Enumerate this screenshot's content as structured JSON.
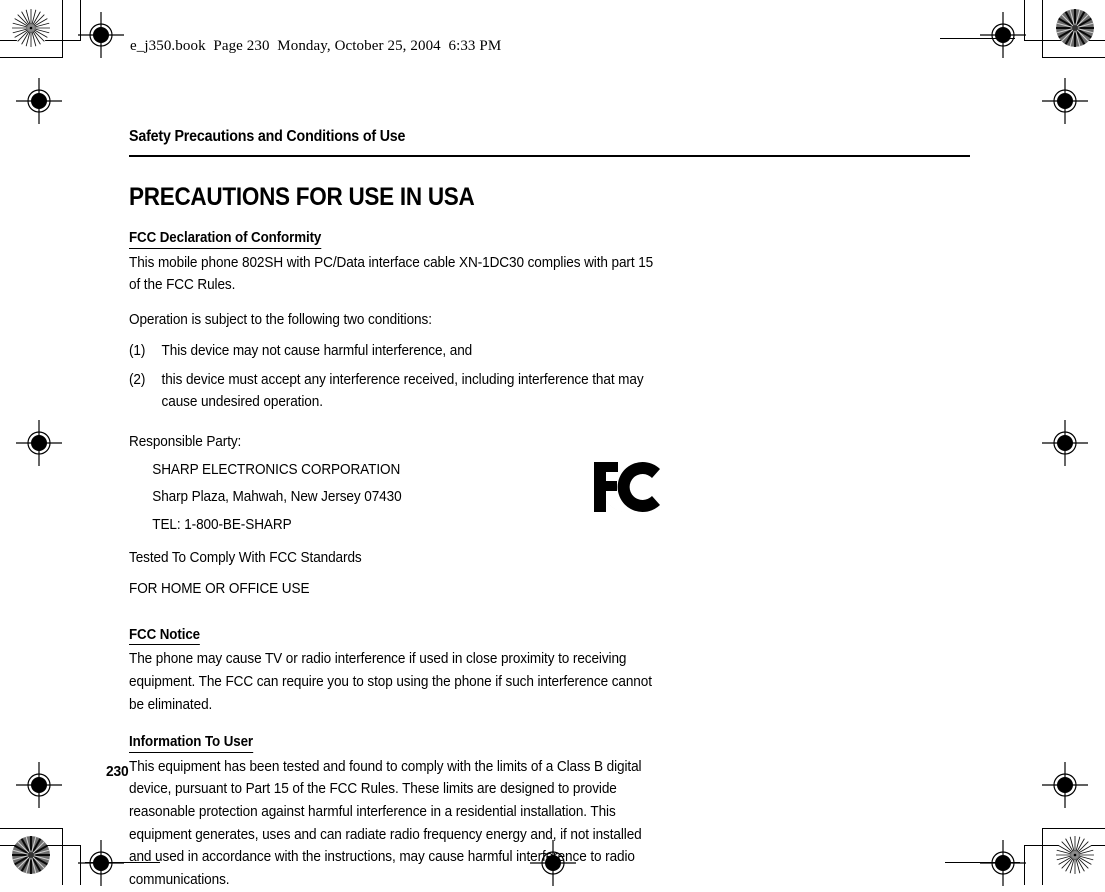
{
  "print_header": "e_j350.book  Page 230  Monday, October 25, 2004  6:33 PM",
  "running_head": "Safety Precautions and Conditions of Use",
  "chapter_title": "PRECAUTIONS FOR USE IN USA",
  "page_number": "230",
  "sections": {
    "declaration": {
      "heading": "FCC Declaration of Conformity",
      "para1": "This mobile phone 802SH with PC/Data interface cable XN-1DC30 complies with part 15 of the FCC Rules.",
      "para2": "Operation is subject to the following two conditions:",
      "conditions": [
        {
          "num": "(1)",
          "text": "This device may not cause harmful interference, and"
        },
        {
          "num": "(2)",
          "text": "this device must accept any interference received, including interference that may cause undesired operation."
        }
      ],
      "responsible_party_label": "Responsible Party:",
      "responsible_party_lines": [
        "SHARP ELECTRONICS CORPORATION",
        "Sharp Plaza, Mahwah, New Jersey 07430",
        "TEL: 1-800-BE-SHARP"
      ],
      "compliance_lines": [
        "Tested To Comply With FCC Standards",
        "FOR HOME OR OFFICE USE"
      ],
      "logo_label": "fcc-logo"
    },
    "fcc_notice": {
      "heading": "FCC Notice",
      "para1": "The phone may cause TV or radio interference if used in close proximity to receiving equipment. The FCC can require you to stop using the phone if such interference cannot be eliminated."
    },
    "information_to_user": {
      "heading": "Information To User",
      "para1": "This equipment has been tested and found to comply with the limits of a Class B digital device, pursuant to Part 15 of the FCC Rules. These limits are designed to provide reasonable protection against harmful interference in a residential installation. This equipment generates, uses and can radiate radio frequency energy and, if not installed and used in accordance with the instructions, may cause harmful interference to radio communications."
    }
  },
  "prepress": {
    "registration_mark_name": "registration-target-icon",
    "star_target_name": "star-density-target-icon",
    "ink_color": "#000000"
  }
}
